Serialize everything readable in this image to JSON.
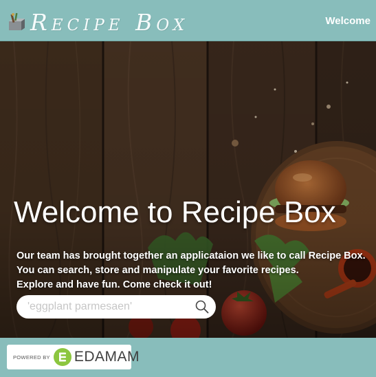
{
  "header": {
    "app_title": "Recipe Box",
    "welcome_link": "Welcome",
    "logo_icon": "recipe-box-icon",
    "background_color": "#88bdbb"
  },
  "hero": {
    "title": "Welcome to Recipe Box",
    "description_lines": [
      "Our team has brought together an applicataion we like to call Recipe Box.",
      "You can search, store and manipulate your favorite recipes.",
      "Explore and have fun. Come check it out!"
    ],
    "search": {
      "placeholder": "'eggplant parmesaen'",
      "value": "",
      "icon": "search-icon"
    }
  },
  "footer": {
    "background_color": "#88bdbb",
    "badge": {
      "powered_by": "POWERED BY",
      "brand_name": "EDAMAM",
      "logo_icon": "edamam-logo-icon",
      "brand_color": "#8cc63f"
    }
  }
}
